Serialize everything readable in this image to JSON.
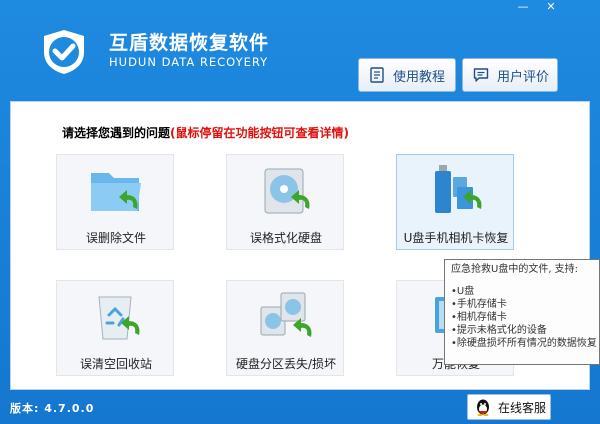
{
  "window": {
    "minimize_glyph": "—",
    "close_glyph": "✕"
  },
  "header": {
    "title": "互盾数据恢复软件",
    "subtitle": "HUDUN DATA RECOYERY",
    "buttons": [
      {
        "label": "使用教程",
        "icon": "document-icon"
      },
      {
        "label": "用户评价",
        "icon": "comment-icon"
      }
    ]
  },
  "main": {
    "prompt": "请选择您遇到的问题",
    "prompt_hint": "(鼠标停留在功能按钮可查看详情)",
    "tiles": [
      {
        "label": "误删除文件",
        "icon": "folder-restore-icon"
      },
      {
        "label": "误格式化硬盘",
        "icon": "hard-drive-restore-icon"
      },
      {
        "label": "U盘手机相机卡恢复",
        "icon": "usb-card-restore-icon"
      },
      {
        "label": "误清空回收站",
        "icon": "recycle-bin-restore-icon"
      },
      {
        "label": "硬盘分区丢失/损坏",
        "icon": "partition-restore-icon"
      },
      {
        "label": "万能恢复",
        "icon": "universal-restore-icon"
      }
    ]
  },
  "tooltip": {
    "heading": "应急抢救U盘中的文件, 支持:",
    "items": [
      "•U盘",
      "•手机存储卡",
      "•相机存储卡",
      "•提示未格式化的设备",
      "•除硬盘损坏所有情况的数据恢复"
    ]
  },
  "footer": {
    "version": "版本: 4.7.0.0",
    "support_label": "在线客服"
  },
  "colors": {
    "accent": "#1577cf",
    "hint_red": "#e0120e",
    "restore_green": "#3ea52c"
  }
}
